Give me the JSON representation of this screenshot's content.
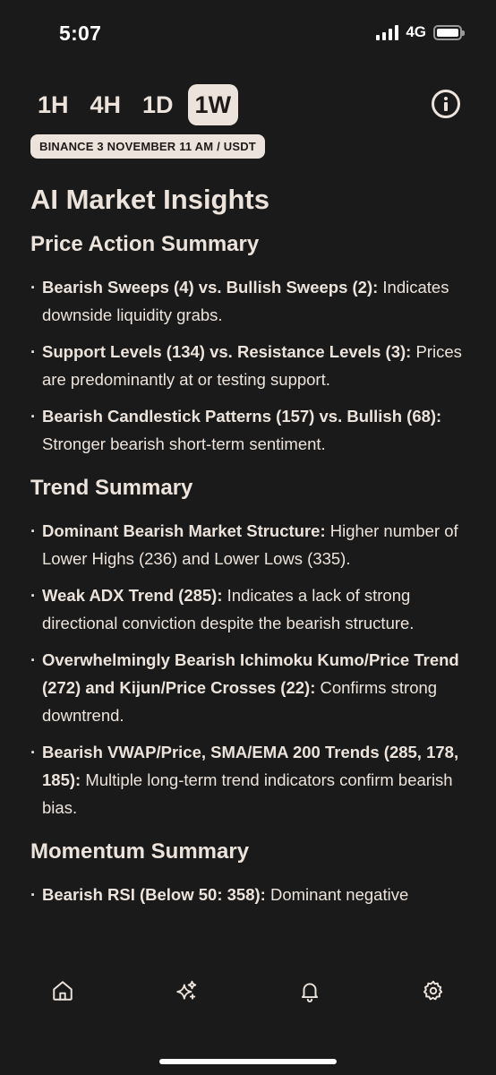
{
  "status": {
    "time": "5:07",
    "network": "4G"
  },
  "timeframes": [
    {
      "label": "1H",
      "active": false
    },
    {
      "label": "4H",
      "active": false
    },
    {
      "label": "1D",
      "active": false
    },
    {
      "label": "1W",
      "active": true
    }
  ],
  "info_icon": "info-icon",
  "source_badge": "BINANCE 3 NOVEMBER 11 AM /  USDT",
  "title": "AI Market Insights",
  "sections": [
    {
      "title": "Price Action Summary",
      "items": [
        {
          "bold": "Bearish Sweeps (4) vs. Bullish Sweeps (2):",
          "text": " Indicates downside liquidity grabs."
        },
        {
          "bold": "Support Levels (134) vs. Resistance Levels (3):",
          "text": " Prices are predominantly at or testing support."
        },
        {
          "bold": "Bearish Candlestick Patterns (157) vs. Bullish (68):",
          "text": " Stronger bearish short-term sentiment."
        }
      ]
    },
    {
      "title": "Trend Summary",
      "items": [
        {
          "bold": "Dominant Bearish Market Structure:",
          "text": " Higher number of Lower Highs (236) and Lower Lows (335)."
        },
        {
          "bold": "Weak ADX Trend (285):",
          "text": " Indicates a lack of strong directional conviction despite the bearish structure."
        },
        {
          "bold": "Overwhelmingly Bearish Ichimoku Kumo/Price Trend (272) and Kijun/Price Crosses (22):",
          "text": " Confirms strong downtrend."
        },
        {
          "bold": "Bearish VWAP/Price, SMA/EMA 200 Trends (285, 178, 185):",
          "text": " Multiple long-term trend indicators confirm bearish bias."
        }
      ]
    },
    {
      "title": "Momentum Summary",
      "items": [
        {
          "bold": "Bearish RSI (Below 50: 358):",
          "text": " Dominant negative"
        }
      ]
    }
  ],
  "tab_bar": [
    {
      "name": "home",
      "icon": "home-icon"
    },
    {
      "name": "insights",
      "icon": "sparkles-icon"
    },
    {
      "name": "alerts",
      "icon": "bell-icon"
    },
    {
      "name": "settings",
      "icon": "gear-icon"
    }
  ],
  "colors": {
    "background": "#1a1a1a",
    "text": "#ece4dc",
    "active_bg": "#ece4dc",
    "active_text": "#1f1a17"
  }
}
